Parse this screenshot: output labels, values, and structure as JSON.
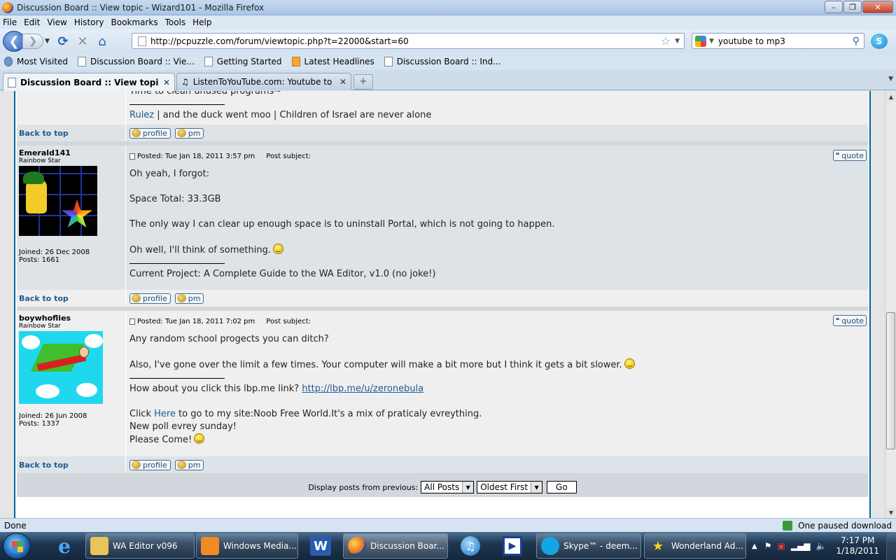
{
  "window": {
    "title": "Discussion Board :: View topic - Wizard101 - Mozilla Firefox",
    "min": "–",
    "max": "❐",
    "close": "✕"
  },
  "menu": [
    "File",
    "Edit",
    "View",
    "History",
    "Bookmarks",
    "Tools",
    "Help"
  ],
  "nav": {
    "url": "http://pcpuzzle.com/forum/viewtopic.php?t=22000&start=60",
    "search_value": "youtube to mp3"
  },
  "bookmarks": [
    {
      "label": "Most Visited",
      "icon": "most-visited-icon"
    },
    {
      "label": "Discussion Board :: Vie...",
      "icon": "page-icon"
    },
    {
      "label": "Getting Started",
      "icon": "page-icon"
    },
    {
      "label": "Latest Headlines",
      "icon": "rss-icon"
    },
    {
      "label": "Discussion Board :: Ind...",
      "icon": "page-icon"
    }
  ],
  "tabs": [
    {
      "label": "Discussion Board :: View topic - W...",
      "active": true
    },
    {
      "label": "ListenToYouTube.com: Youtube to ...",
      "active": false
    }
  ],
  "tab_close": "✕",
  "newtab": "+",
  "prev_post": {
    "text_partial": "Time to clean unused programs~",
    "sig_link": "Rulez",
    "sig_rest": " | and the duck went moo | Children of Israel are never alone"
  },
  "buttons": {
    "back_to_top": "Back to top",
    "profile": "profile",
    "pm": "pm",
    "quote": "quote"
  },
  "posts": [
    {
      "author": "Emerald141",
      "rank": "Rainbow Star",
      "joined": "Joined: 26 Dec 2008",
      "posts": "Posts: 1661",
      "posted": "Posted: Tue Jan 18, 2011 3:57 pm",
      "subject": "Post subject:",
      "lines": [
        "Oh yeah, I forgot:",
        "Space Total: 33.3GB",
        "The only way I can clear up enough space is to uninstall Portal, which is not going to happen.",
        "Oh well, I'll think of something."
      ],
      "signature": "Current Project: A Complete Guide to the WA Editor, v1.0 (no joke!)"
    },
    {
      "author": "boywhoflies",
      "rank": "Rainbow Star",
      "joined": "Joined: 26 Jun 2008",
      "posts": "Posts: 1337",
      "posted": "Posted: Tue Jan 18, 2011 7:02 pm",
      "subject": "Post subject:",
      "lines": [
        "Any random school progects you can ditch?",
        "Also, I've gone over the limit a few times. Your computer will make a bit more but I think it gets a bit slower."
      ],
      "sig_prefix": "How about you click this lbp.me link? ",
      "sig_url": "http://lbp.me/u/zeronebula",
      "sig2_prefix": "Click ",
      "sig2_link": "Here",
      "sig2_rest": " to go to my site:Noob Free World.It's a mix of praticaly evreything.",
      "sig3": "New poll evrey sunday!",
      "sig4": "Please Come!"
    }
  ],
  "display_bar": {
    "label": "Display posts from previous:",
    "posts_select": "All Posts",
    "order_select": "Oldest First",
    "go": "Go"
  },
  "status": {
    "text": "Done",
    "download": "One paused download"
  },
  "taskbar": {
    "buttons": [
      {
        "label": "WA Editor v096",
        "icon": "folder-icon",
        "color": "#e8c45a"
      },
      {
        "label": "Windows Media...",
        "icon": "media-player-icon",
        "color": "#f08a24"
      },
      {
        "label": "Discussion Boar...",
        "icon": "firefox-icon",
        "color": "#e8691c",
        "active": true
      },
      {
        "label": "Skype™ - deem...",
        "icon": "skype-icon",
        "color": "#13a6e4"
      },
      {
        "label": "Wonderland Ad...",
        "icon": "star-icon",
        "color": "#f3d12a"
      }
    ],
    "time": "7:17 PM",
    "date": "1/18/2011"
  }
}
